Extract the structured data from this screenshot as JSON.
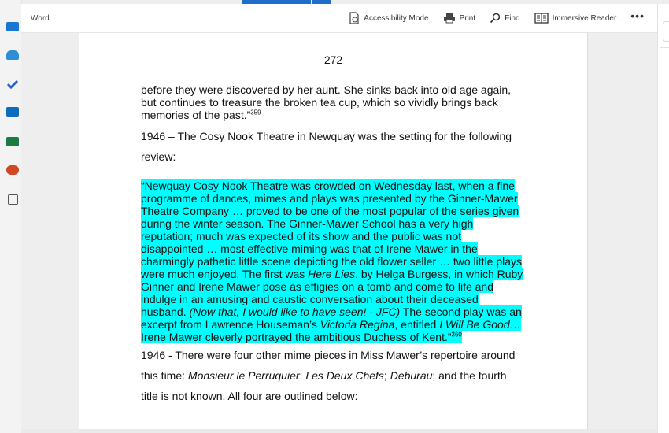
{
  "app": {
    "name": "Word"
  },
  "toolbar": {
    "accessibility": "Accessibility Mode",
    "print": "Print",
    "find": "Find",
    "reader": "Immersive Reader",
    "more": "•••"
  },
  "rail_icons": [
    "calendar-icon",
    "people-icon",
    "todo-icon",
    "outlook-icon",
    "excel-icon",
    "powerpoint-icon",
    "apps-grid-icon"
  ],
  "colors": {
    "accent": "#1f6ec8",
    "highlight": "#00ffff"
  },
  "document": {
    "page_number": "272",
    "p1": {
      "text": "before they were discovered by her aunt. She sinks back into old age again, but continues to treasure the broken tea cup, which so vividly brings back memories of the past.”",
      "note": "359"
    },
    "p2": "1946 – The Cosy Nook Theatre in Newquay was the setting for the following review:",
    "quote": {
      "a": "“Newquay Cosy Nook Theatre was crowded on Wednesday last, when a fine programme of dances, mimes and plays was presented by the Ginner-Mawer Theatre Company … proved to be one of the most popular of the series given during the winter season. The Ginner-Mawer School has a very high reputation; much was expected of its show and the public was not disappointed … most effective miming was that of Irene Mawer in the charmingly pathetic little scene depicting the old flower seller … two little plays were much enjoyed. The first was ",
      "a_it": "Here Lies",
      "b": ", by Helga Burgess, in which Ruby Ginner and Irene Mawer pose as effigies on a tomb and come to life and indulge in an amusing and caustic conversation about their deceased husband. ",
      "b_it": "(Now that, I would like to have seen! - JFC)",
      "c": " The second play was an excerpt from Lawrence Houseman’s ",
      "c_it": "Victoria Regina",
      "d": ", entitled ",
      "d_it": "I Will Be Good",
      "e": "…Irene Mawer cleverly portrayed the ambitious Duchess of Kent.”",
      "note": "360"
    },
    "p3": {
      "a": "1946 - There were four other mime pieces in Miss Mawer’s repertoire around this time: ",
      "t1": "Monsieur le Perruquier",
      "s1": "; ",
      "t2": "Les Deux Chefs",
      "s2": "; ",
      "t3": "Deburau",
      "b": "; and the fourth title is not known. All four are outlined below:"
    }
  }
}
